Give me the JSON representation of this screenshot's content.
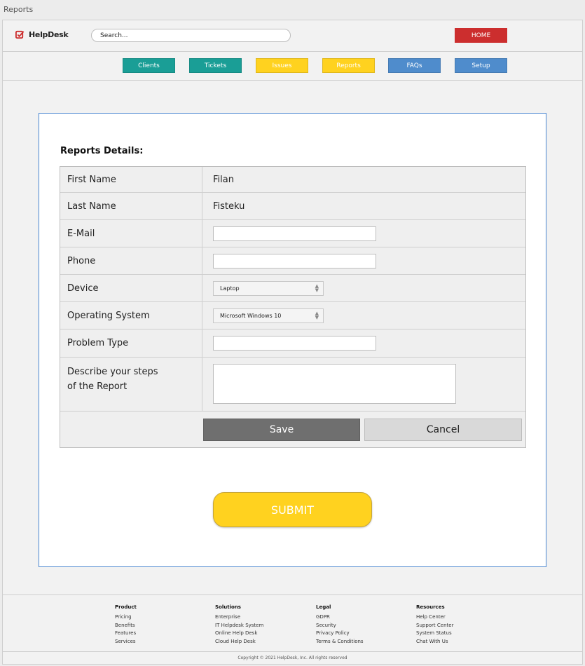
{
  "window": {
    "title": "Reports"
  },
  "header": {
    "logo_text": "HelpDesk",
    "search_placeholder": "Search...",
    "home_label": "HOME"
  },
  "nav": [
    {
      "label": "Clients",
      "color": "#1a9e96"
    },
    {
      "label": "Tickets",
      "color": "#1a9e96"
    },
    {
      "label": "Issues",
      "color": "#ffd21f"
    },
    {
      "label": "Reports",
      "color": "#ffd21f"
    },
    {
      "label": "FAQs",
      "color": "#4f8ccc"
    },
    {
      "label": "Setup",
      "color": "#4f8ccc"
    }
  ],
  "form": {
    "title": "Reports Details:",
    "first_name_label": "First Name",
    "first_name_value": "Filan",
    "last_name_label": "Last Name",
    "last_name_value": "Fisteku",
    "email_label": "E-Mail",
    "phone_label": "Phone",
    "device_label": "Device",
    "device_value": "Laptop",
    "os_label": "Operating System",
    "os_value": "Microsoft Windows 10",
    "problem_label": "Problem Type",
    "steps_label_1": "Describe your steps",
    "steps_label_2": "of the Report",
    "save_label": "Save",
    "cancel_label": "Cancel",
    "submit_label": "SUBMIT"
  },
  "footer": {
    "columns": [
      {
        "heading": "Product",
        "links": [
          "Pricing",
          "Benefits",
          "Features",
          "Services"
        ]
      },
      {
        "heading": "Solutions",
        "links": [
          "Enterprise",
          "IT Helpdesk System",
          "Online Help Desk",
          "Cloud Help Desk"
        ]
      },
      {
        "heading": "Legal",
        "links": [
          "GDPR",
          "Security",
          "Privacy Policy",
          "Terms & Conditions"
        ]
      },
      {
        "heading": "Resources",
        "links": [
          "Help Center",
          "Support Center",
          "System Status",
          "Chat With Us"
        ]
      }
    ],
    "copyright": "Copyright © 2021 HelpDesk, Inc. All rights reserved"
  }
}
